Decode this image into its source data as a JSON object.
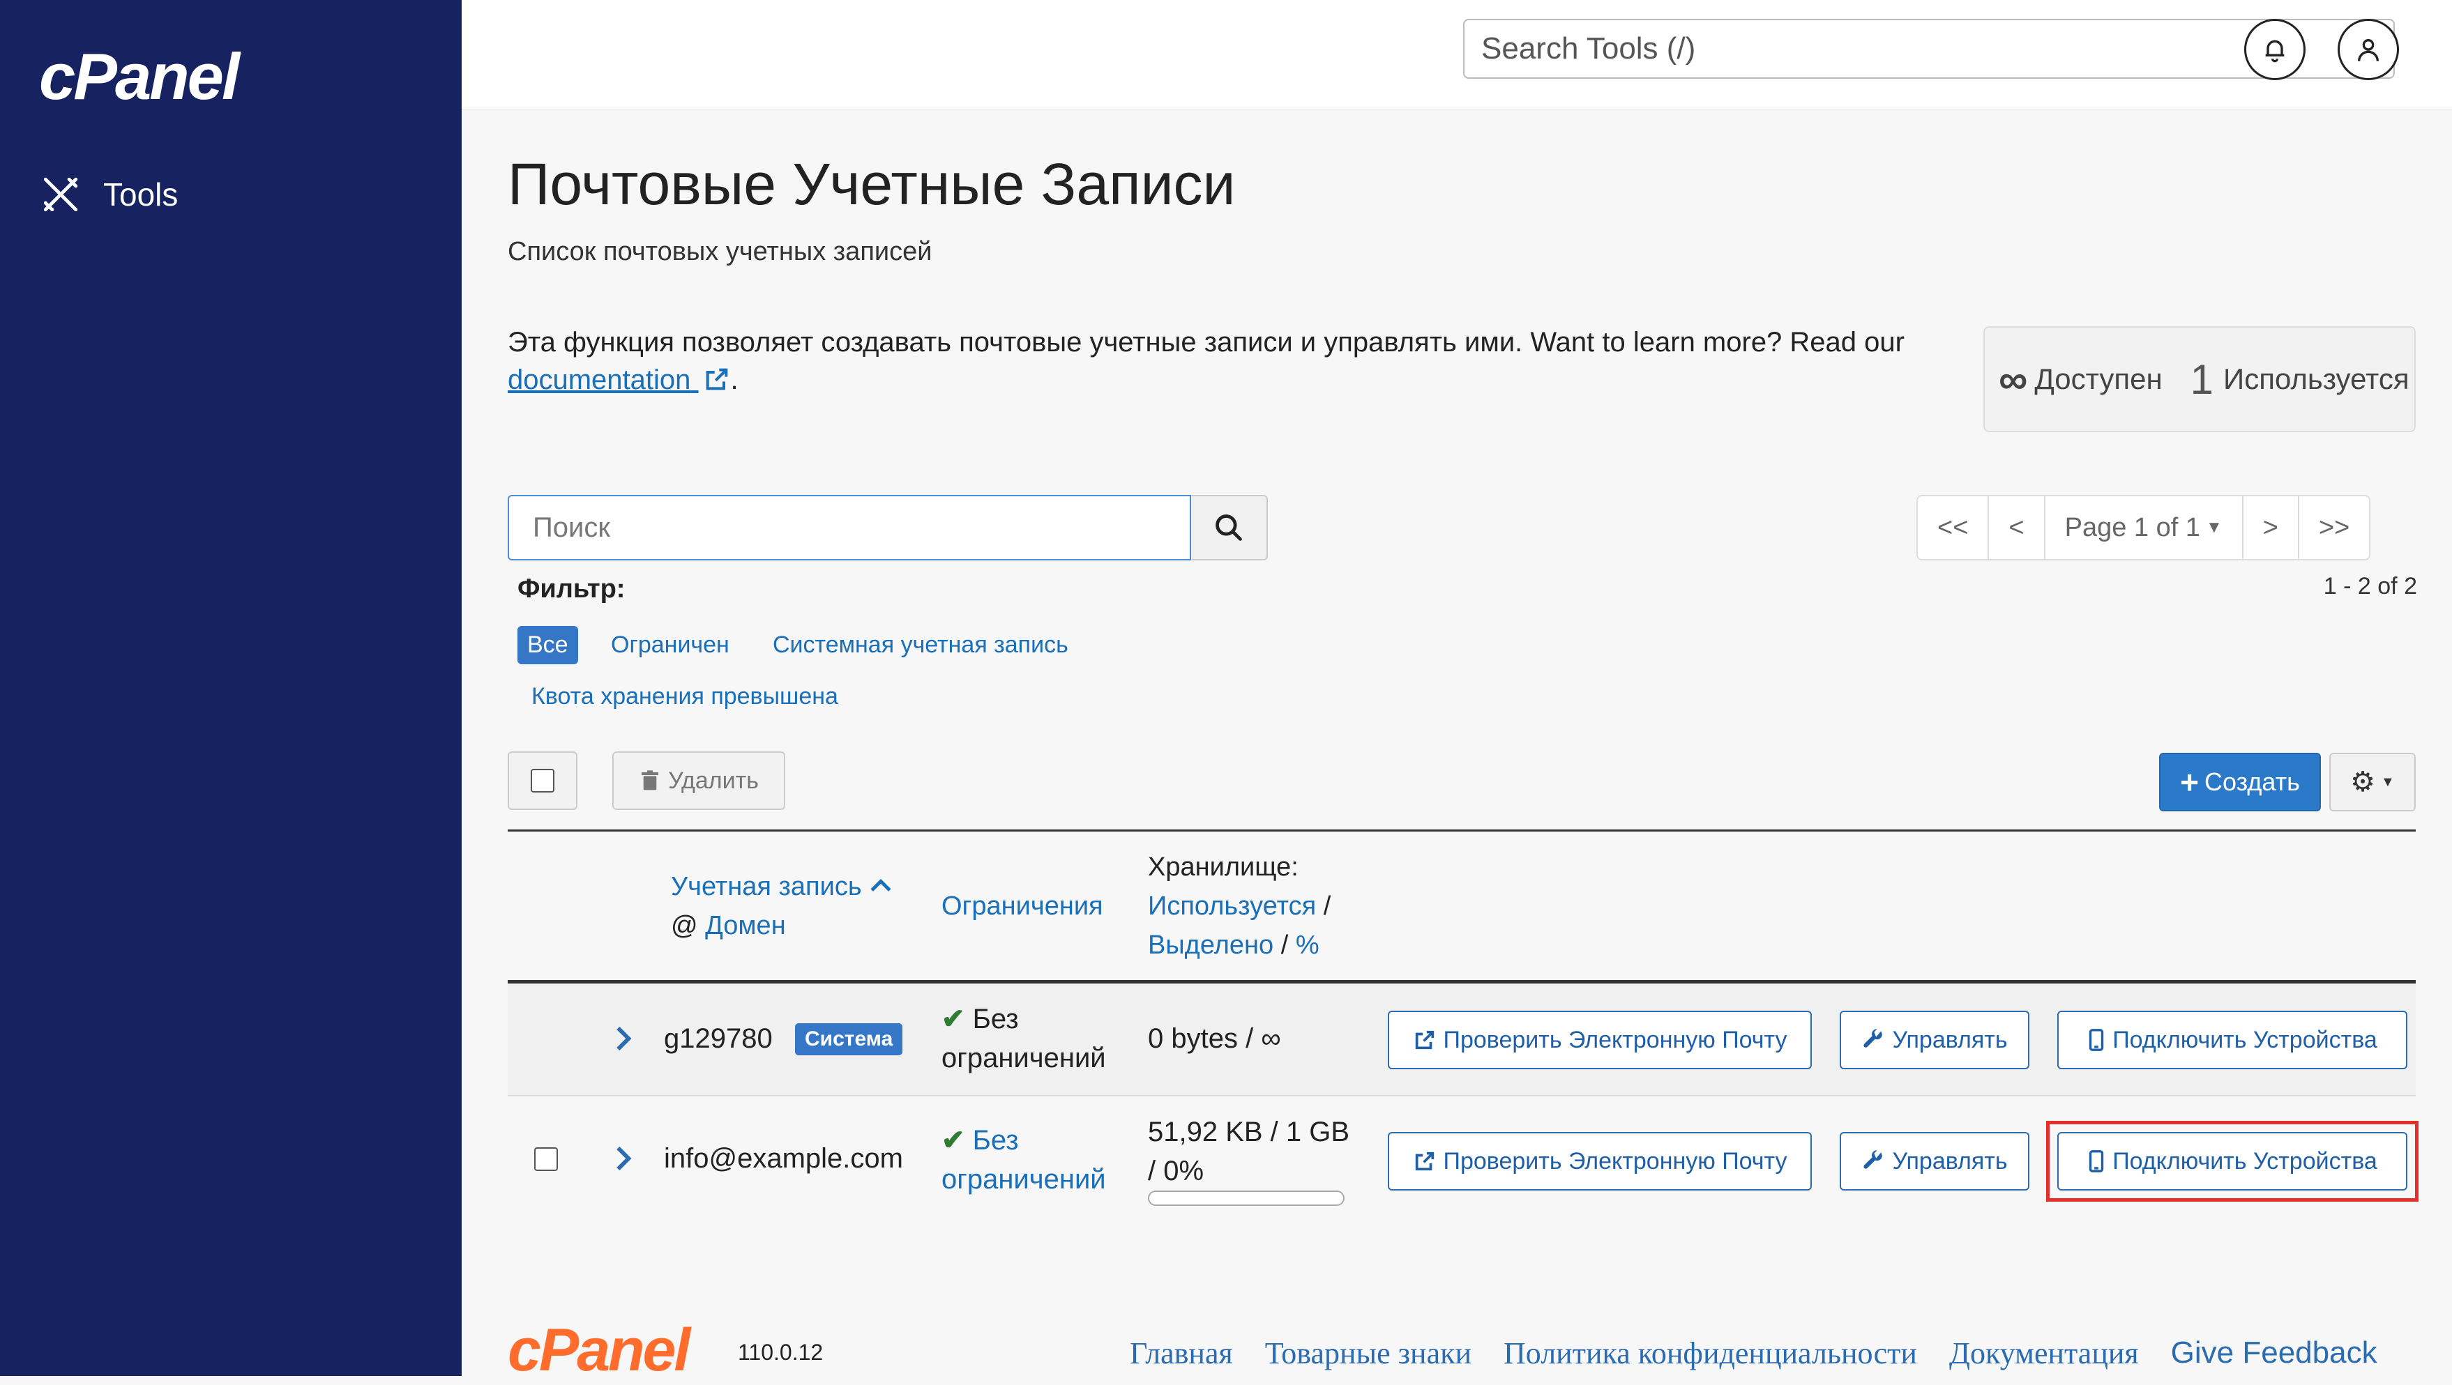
{
  "sidebar": {
    "logo": "cPanel",
    "nav": {
      "tools_label": "Tools",
      "icon": "tools-icon"
    }
  },
  "topbar": {
    "search_placeholder": "Search Tools (/)",
    "search_icon": "search-icon",
    "notifications_icon": "bell-icon",
    "user_icon": "user-icon"
  },
  "page": {
    "title": "Почтовые Учетные Записи",
    "subtitle": "Список почтовых учетных записей",
    "description": "Эта функция позволяет создавать почтовые учетные записи и управлять ими. Want to learn more? Read our",
    "doc_link": "documentation",
    "period": "."
  },
  "stats": {
    "available_symbol": "∞",
    "available_label": "Доступен",
    "used_count": "1",
    "used_label": "Используется"
  },
  "search": {
    "placeholder": "Поиск",
    "icon": "search-icon"
  },
  "pagination": {
    "first": "<<",
    "prev": "<",
    "page_label": "Page 1 of 1",
    "next": ">",
    "last": ">>",
    "count": "1 - 2 of 2"
  },
  "filter": {
    "label": "Фильтр:",
    "options": [
      "Все",
      "Ограничен",
      "Системная учетная запись",
      "Квота хранения превышена"
    ],
    "active": "Все"
  },
  "toolbar": {
    "delete_label": "Удалить",
    "create_label": "Создать",
    "settings_icon": "gear-icon"
  },
  "table": {
    "header": {
      "account": "Учетная запись",
      "at": "@",
      "domain": "Домен",
      "limits": "Ограничения",
      "storage": "Хранилище:",
      "used": "Используется",
      "slash1": "/",
      "allocated": "Выделено",
      "slash2": "/",
      "percent": "%"
    },
    "rows": [
      {
        "account": "g129780",
        "badge": "Система",
        "limits_line1": "Без",
        "limits_line2": "ограничений",
        "storage_line1": "0 bytes / ∞",
        "storage_line2": "",
        "usage_fraction": 0,
        "check_email": "Проверить Электронную Почту",
        "manage": "Управлять",
        "connect": "Подключить Устройства"
      },
      {
        "account": "info@example.com",
        "badge": "",
        "limits_line1": "Без",
        "limits_line2": "ограничений",
        "storage_line1": "51,92 KB / 1 GB",
        "storage_line2": "/ 0%",
        "usage_fraction": 0,
        "check_email": "Проверить Электронную Почту",
        "manage": "Управлять",
        "connect": "Подключить Устройства"
      }
    ]
  },
  "footer": {
    "logo": "cPanel",
    "version": "110.0.12",
    "links": [
      "Главная",
      "Товарные знаки",
      "Политика конфиденциальности",
      "Документация",
      "Give Feedback"
    ]
  }
}
